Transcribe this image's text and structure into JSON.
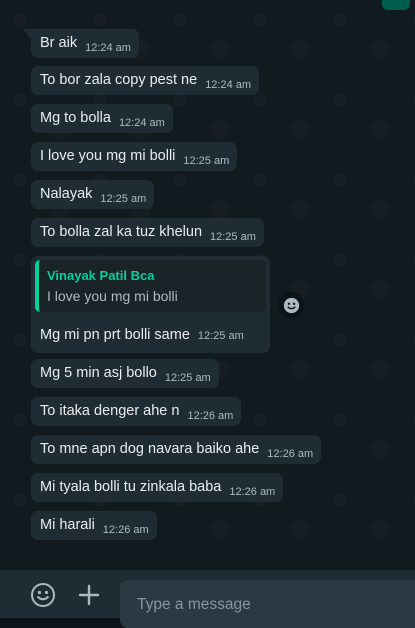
{
  "messages": [
    {
      "text": "Br aik",
      "time": "12:24 am"
    },
    {
      "text": "To  bor zala copy pest ne",
      "time": "12:24 am"
    },
    {
      "text": "Mg to bolla",
      "time": "12:24 am"
    },
    {
      "text": "I love  you mg mi bolli",
      "time": "12:25 am"
    },
    {
      "text": "Nalayak",
      "time": "12:25 am"
    },
    {
      "text": "To bolla zal ka tuz khelun",
      "time": "12:25 am"
    },
    {
      "text": "Mg 5 min asj bollo",
      "time": "12:25 am"
    },
    {
      "text": "To itaka denger ahe n",
      "time": "12:26 am"
    },
    {
      "text": "To mne apn dog navara baiko ahe",
      "time": "12:26 am"
    },
    {
      "text": "Mi tyala bolli tu zinkala baba",
      "time": "12:26 am"
    },
    {
      "text": "Mi harali",
      "time": "12:26 am"
    }
  ],
  "quoted_message": {
    "quote_author": "Vinayak Patil Bca",
    "quote_text": "I love  you mg mi bolli",
    "text": "Mg mi pn prt bolli same",
    "time": "12:25 am"
  },
  "reaction": {
    "icon": "smiley-icon"
  },
  "footer": {
    "emoji_icon": "smiley-icon",
    "attach_icon": "plus-icon",
    "input_placeholder": "Type a message"
  },
  "colors": {
    "bubble": "#202c33",
    "chat_bg": "#111a1f",
    "accent": "#06cf9c",
    "text": "#e9edef",
    "meta": "#aebac1"
  }
}
